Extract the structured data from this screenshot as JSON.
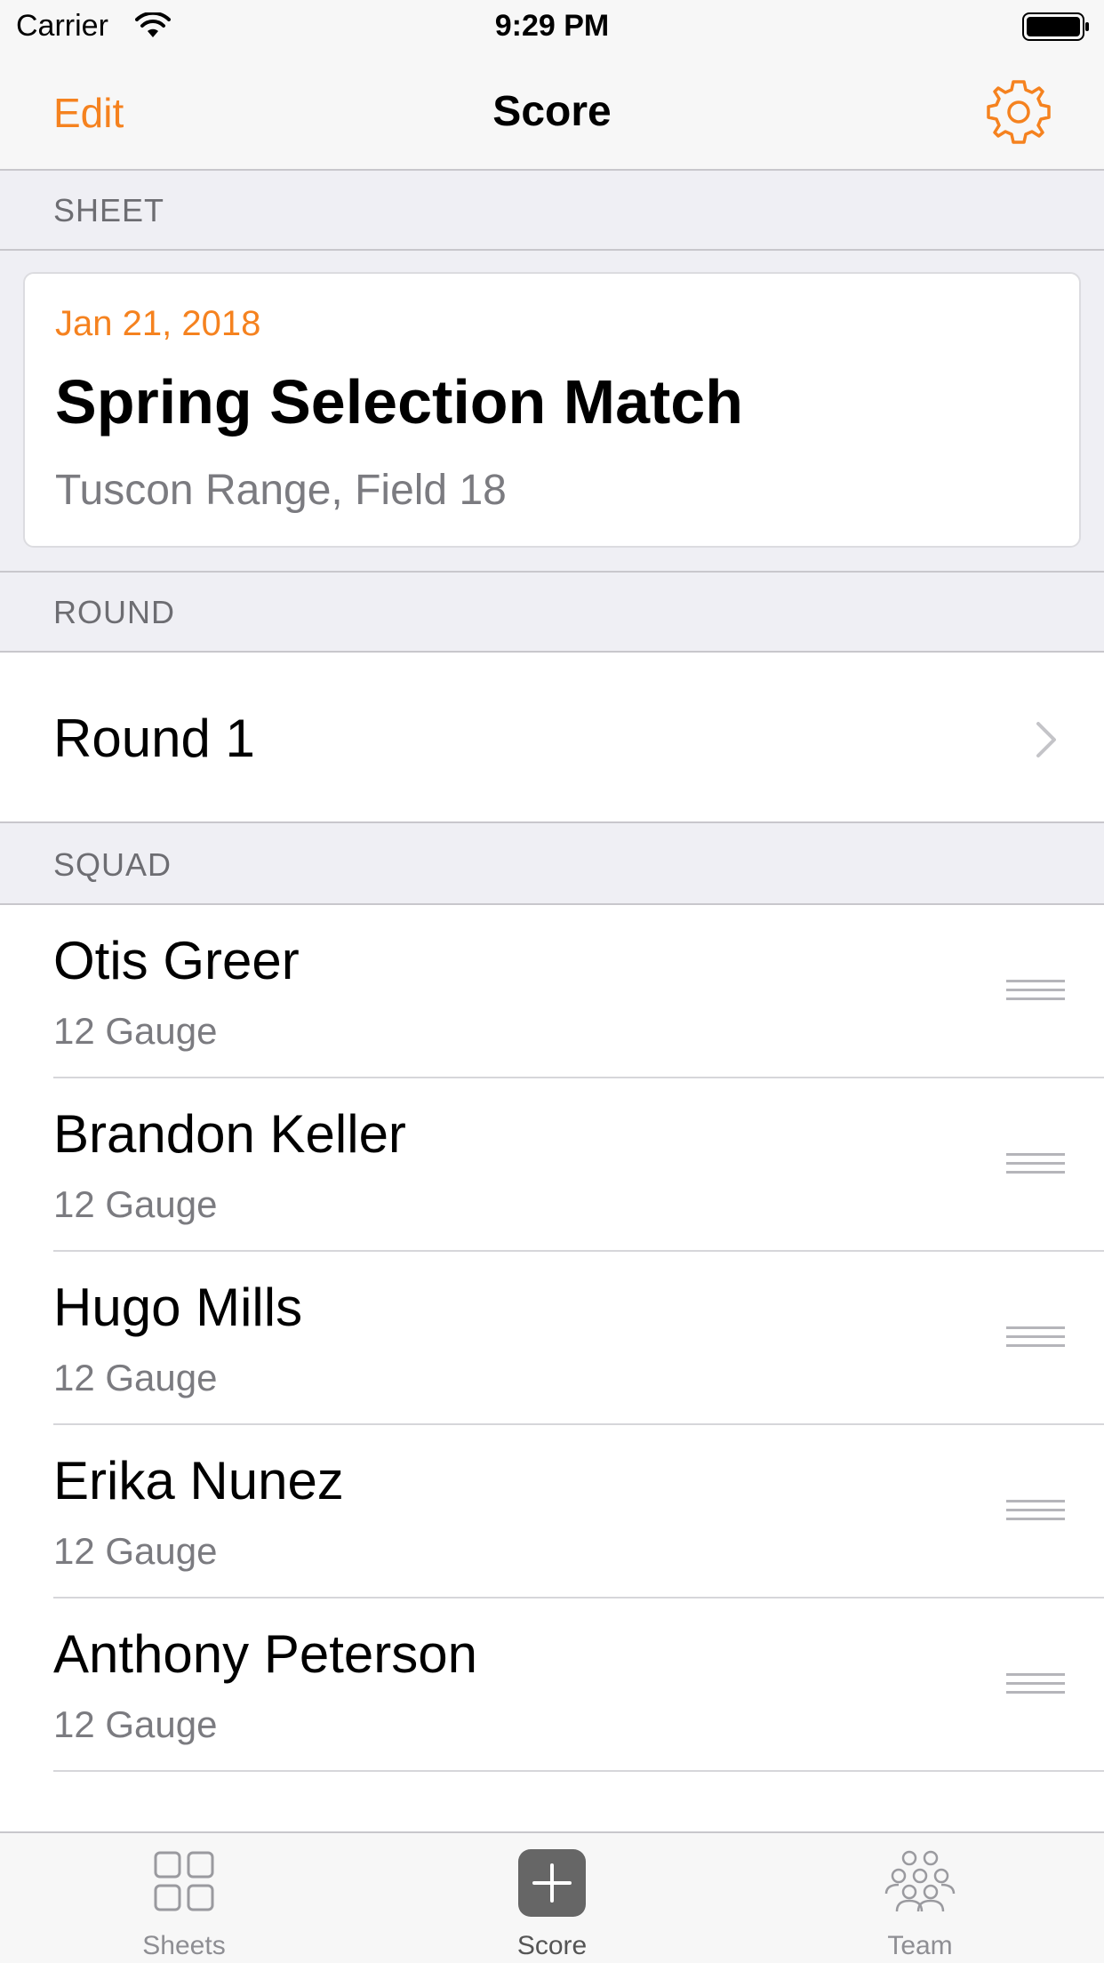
{
  "status_bar": {
    "carrier": "Carrier",
    "time": "9:29 PM"
  },
  "nav": {
    "edit_label": "Edit",
    "title": "Score",
    "settings_icon": "gear-icon"
  },
  "sections": {
    "sheet": "SHEET",
    "round": "ROUND",
    "squad": "SQUAD"
  },
  "sheet": {
    "date": "Jan 21, 2018",
    "title": "Spring Selection Match",
    "location": "Tuscon Range, Field 18"
  },
  "round": {
    "label": "Round 1"
  },
  "squad": [
    {
      "name": "Otis Greer",
      "gauge": "12 Gauge"
    },
    {
      "name": "Brandon Keller",
      "gauge": "12 Gauge"
    },
    {
      "name": "Hugo Mills",
      "gauge": "12 Gauge"
    },
    {
      "name": "Erika Nunez",
      "gauge": "12 Gauge"
    },
    {
      "name": "Anthony Peterson",
      "gauge": "12 Gauge"
    }
  ],
  "tabs": [
    {
      "label": "Sheets",
      "icon": "grid-icon"
    },
    {
      "label": "Score",
      "icon": "plus-icon",
      "active": true
    },
    {
      "label": "Team",
      "icon": "team-icon"
    }
  ],
  "colors": {
    "accent": "#f5821f",
    "section_bg": "#efeff4"
  }
}
